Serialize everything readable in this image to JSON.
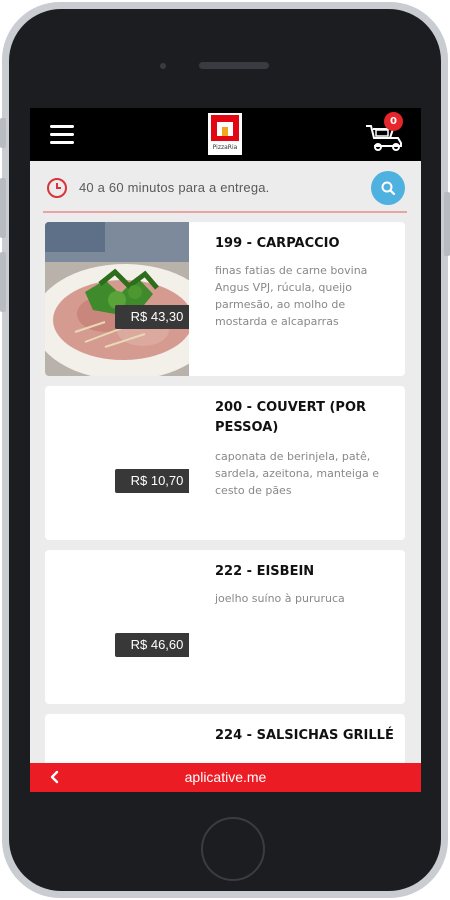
{
  "header": {
    "logo_text": "PizzaRia",
    "cart_count": "0"
  },
  "search": {
    "delivery_text": "40 a 60 minutos para a entrega."
  },
  "products": [
    {
      "title": "199 - CARPACCIO",
      "description": "finas fatias de carne bovina Angus VPJ, rúcula, queijo parmesão, ao molho de mostarda e alcaparras",
      "price": "R$ 43,30"
    },
    {
      "title": "200 - COUVERT (POR PESSOA)",
      "description": "caponata de berinjela, patê, sardela, azeitona, manteiga e cesto de pães",
      "price": "R$ 10,70"
    },
    {
      "title": "222 - EISBEIN",
      "description": "joelho suíno à pururuca",
      "price": "R$ 46,60"
    },
    {
      "title": "224 - SALSICHAS GRILLÉ",
      "description": "",
      "price": ""
    }
  ],
  "footer": {
    "site": "aplicative.me"
  },
  "colors": {
    "accent_red": "#ec1c24",
    "search_blue": "#4fb1df",
    "price_bg": "#383838"
  }
}
